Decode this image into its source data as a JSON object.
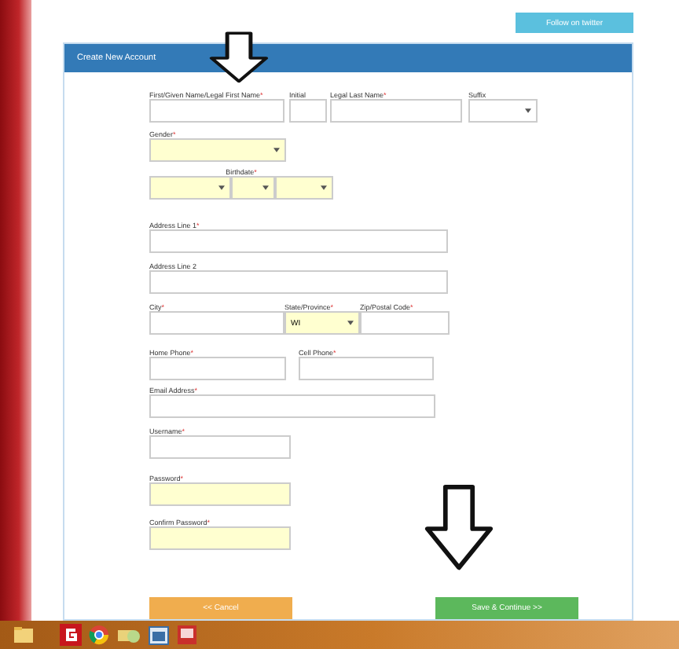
{
  "top_button": "Follow on twitter",
  "panel": {
    "title": "Create New Account"
  },
  "rows": [
    [
      {
        "kind": "text",
        "label": "First/Given Name/Legal First Name",
        "mark": "*",
        "highlighted": false
      },
      {
        "kind": "text",
        "label": "Initial",
        "highlighted": false
      },
      {
        "kind": "text",
        "label": "Legal Last Name",
        "mark": "*",
        "highlighted": false
      },
      {
        "kind": "select",
        "label": "Suffix",
        "highlighted": false
      }
    ],
    [
      {
        "kind": "select",
        "label": "Gender",
        "mark": "*",
        "highlighted": true
      }
    ],
    [
      {
        "kind": "date",
        "label": "Birthdate",
        "mark": "*",
        "parts": [
          {
            "highlighted": true
          },
          {
            "highlighted": true
          },
          {
            "highlighted": true
          }
        ]
      }
    ],
    [
      {
        "kind": "text",
        "label": "Address Line 1",
        "mark": "*",
        "highlighted": false
      }
    ],
    [
      {
        "kind": "text",
        "label": "Address Line 2",
        "highlighted": false
      }
    ],
    [
      {
        "kind": "text",
        "label": "City",
        "mark": "*",
        "highlighted": false
      },
      {
        "kind": "select",
        "label": "State/Province",
        "mark": "*",
        "value": "WI",
        "highlighted": true
      },
      {
        "kind": "text",
        "label": "Zip/Postal Code",
        "mark": "*",
        "highlighted": false
      }
    ],
    [
      {
        "kind": "text",
        "label": "Home Phone",
        "mark": "*",
        "highlighted": false
      },
      {
        "kind": "text",
        "label": "Cell Phone",
        "mark": "*",
        "highlighted": false
      }
    ],
    [
      {
        "kind": "text",
        "label": "Email Address",
        "mark": "*",
        "highlighted": false
      }
    ],
    [
      {
        "kind": "text",
        "label": "Username",
        "mark": "*",
        "highlighted": false
      }
    ],
    [
      {
        "kind": "password",
        "label": "Password",
        "mark": "*",
        "highlighted": true
      }
    ],
    [
      {
        "kind": "password",
        "label": "Confirm Password",
        "mark": "*",
        "highlighted": true
      }
    ]
  ],
  "buttons": [
    {
      "label": "<< Cancel",
      "kind": "cancel"
    },
    {
      "label": "Save & Continue >>",
      "kind": "save"
    }
  ]
}
